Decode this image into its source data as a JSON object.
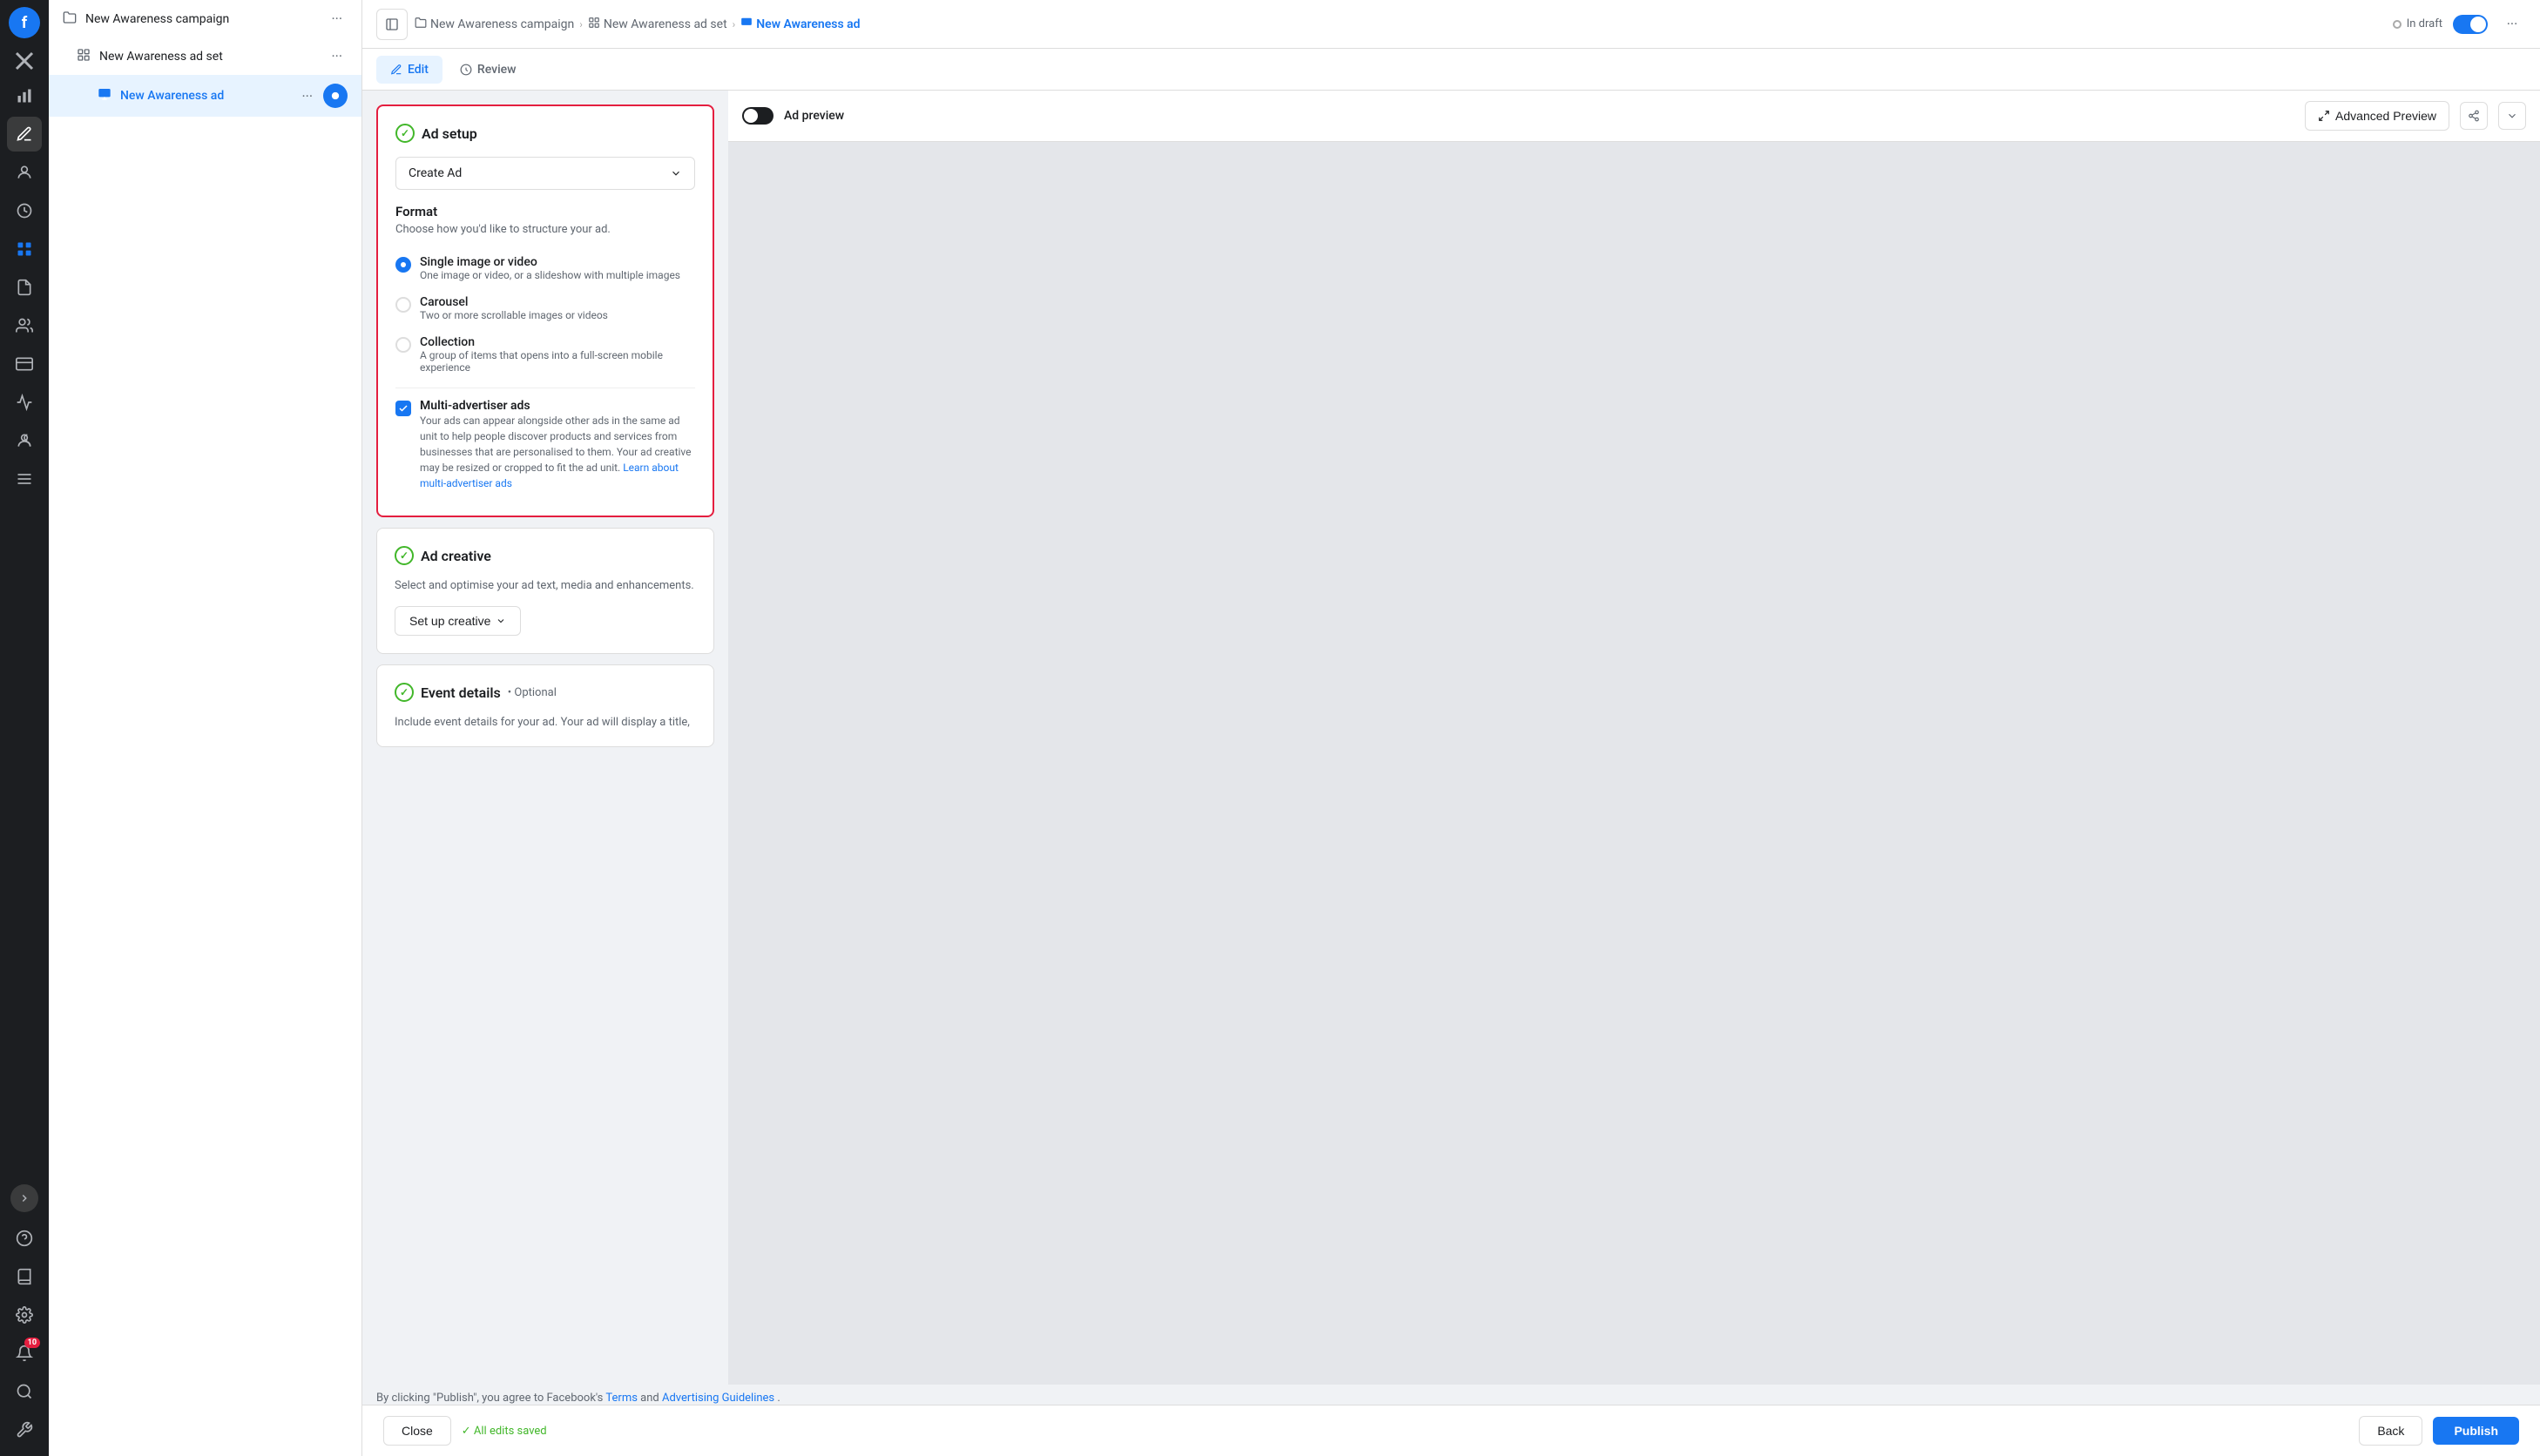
{
  "app": {
    "logo": "f"
  },
  "sidebar": {
    "icons": [
      {
        "name": "close-icon",
        "symbol": "✕"
      },
      {
        "name": "chart-icon",
        "symbol": "📊"
      },
      {
        "name": "edit-icon",
        "symbol": "✏️"
      },
      {
        "name": "user-icon",
        "symbol": "👤"
      },
      {
        "name": "clock-icon",
        "symbol": "🕐"
      },
      {
        "name": "grid-icon",
        "symbol": "⊞"
      },
      {
        "name": "document-icon",
        "symbol": "📄"
      },
      {
        "name": "people-icon",
        "symbol": "👥"
      },
      {
        "name": "card-icon",
        "symbol": "💳"
      },
      {
        "name": "signal-icon",
        "symbol": "📶"
      },
      {
        "name": "settings-icon",
        "symbol": "⚙"
      },
      {
        "name": "help-icon",
        "symbol": "?"
      },
      {
        "name": "book-icon",
        "symbol": "📖"
      },
      {
        "name": "gear-icon",
        "symbol": "⚙"
      },
      {
        "name": "bell-icon",
        "symbol": "🔔",
        "badge": "10"
      },
      {
        "name": "search-icon",
        "symbol": "🔍"
      },
      {
        "name": "wrench-icon",
        "symbol": "🔧"
      }
    ]
  },
  "nav": {
    "items": [
      {
        "id": "campaign",
        "label": "New Awareness campaign",
        "level": 0,
        "icon": "📁",
        "selected": false
      },
      {
        "id": "adset",
        "label": "New Awareness ad set",
        "level": 1,
        "icon": "⊞",
        "selected": false
      },
      {
        "id": "ad",
        "label": "New Awareness ad",
        "level": 2,
        "icon": "🗂",
        "selected": true
      }
    ]
  },
  "topbar": {
    "breadcrumbs": [
      {
        "label": "New Awareness campaign",
        "icon": "📁",
        "active": false
      },
      {
        "label": "New Awareness ad set",
        "icon": "⊞",
        "active": false
      },
      {
        "label": "New Awareness ad",
        "icon": "🗂",
        "active": true
      }
    ],
    "status": "In draft",
    "more_label": "···"
  },
  "tabs": {
    "edit_label": "Edit",
    "review_label": "Review"
  },
  "ad_setup": {
    "title": "Ad setup",
    "dropdown_label": "Create Ad",
    "format_title": "Format",
    "format_desc": "Choose how you'd like to structure your ad.",
    "options": [
      {
        "id": "single",
        "title": "Single image or video",
        "subtitle": "One image or video, or a slideshow with multiple images",
        "selected": true
      },
      {
        "id": "carousel",
        "title": "Carousel",
        "subtitle": "Two or more scrollable images or videos",
        "selected": false
      },
      {
        "id": "collection",
        "title": "Collection",
        "subtitle": "A group of items that opens into a full-screen mobile experience",
        "selected": false
      }
    ],
    "multi_advertiser": {
      "title": "Multi-advertiser ads",
      "description": "Your ads can appear alongside other ads in the same ad unit to help people discover products and services from businesses that are personalised to them. Your ad creative may be resized or cropped to fit the ad unit.",
      "link_text": "Learn about multi-advertiser ads",
      "checked": true
    }
  },
  "ad_creative": {
    "title": "Ad creative",
    "description": "Select and optimise your ad text, media and enhancements.",
    "setup_btn": "Set up creative"
  },
  "event_details": {
    "title": "Event details",
    "optional_label": "• Optional",
    "description": "Include event details for your ad. Your ad will display a title,"
  },
  "preview": {
    "title": "Ad preview",
    "advanced_label": "Advanced Preview"
  },
  "footer": {
    "publish_text": "By clicking \"Publish\", you agree to Facebook's",
    "link1": "Terms",
    "and_text": "and",
    "link2": "Advertising Guidelines",
    "period": ".",
    "close_label": "Close",
    "saved_label": "✓ All edits saved",
    "back_label": "Back",
    "publish_label": "Publish"
  }
}
